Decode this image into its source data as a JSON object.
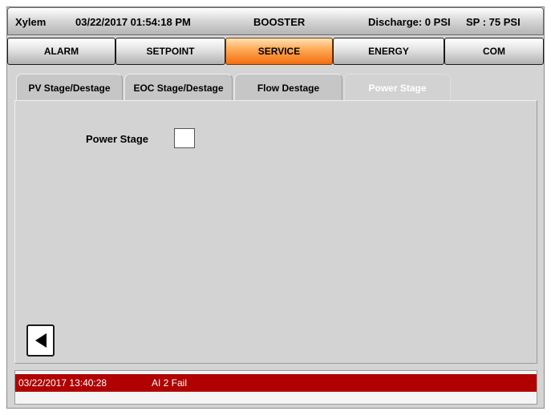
{
  "header": {
    "brand": "Xylem",
    "datetime": "03/22/2017 01:54:18 PM",
    "mode": "BOOSTER",
    "discharge": "Discharge: 0 PSI",
    "setpoint": "SP : 75 PSI"
  },
  "nav": {
    "alarm": "ALARM",
    "setpoint": "SETPOINT",
    "service": "SERVICE",
    "energy": "ENERGY",
    "com": "COM",
    "active": "SERVICE",
    "active_color": "#f36d10"
  },
  "tabs": {
    "pv": "PV Stage/Destage",
    "eoc": "EOC Stage/Destage",
    "flow": "Flow Destage",
    "power": "Power Stage",
    "active": "Power Stage"
  },
  "main": {
    "power_stage_label": "Power Stage",
    "power_stage_value": ""
  },
  "alarm_banner": {
    "timestamp": "03/22/2017 13:40:28",
    "message": "AI 2 Fail",
    "color": "#b00000"
  },
  "icons": {
    "back": "back-arrow-icon"
  }
}
